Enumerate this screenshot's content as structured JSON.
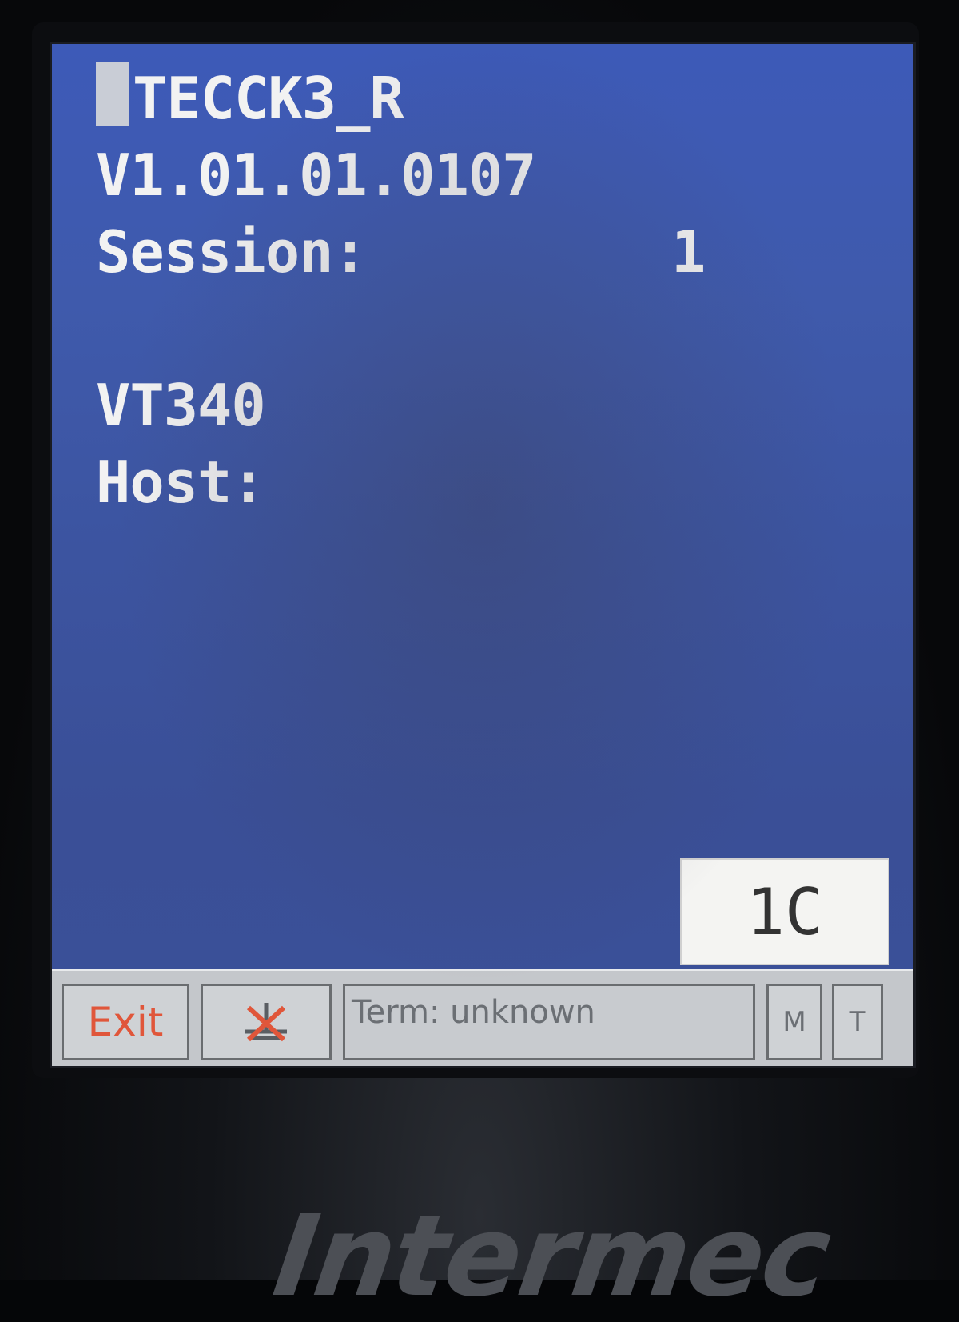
{
  "terminal": {
    "app_name": "TECCK3_R",
    "version": "V1.01.01.0107",
    "session_label": "Session:",
    "session_value": "1",
    "emulation": "VT340",
    "host_label": "Host:"
  },
  "badge": {
    "label": "1C"
  },
  "taskbar": {
    "exit_label": "Exit",
    "status_text": "Term: unknown",
    "m_label": "M",
    "t_label": "T"
  },
  "device": {
    "brand": "Intermec"
  },
  "colors": {
    "screen_blue": "#3d57a8",
    "exit_red": "#e0563a",
    "taskbar_gray": "#c4c7cb"
  },
  "icons": {
    "status_icon": "no-signal-icon"
  }
}
